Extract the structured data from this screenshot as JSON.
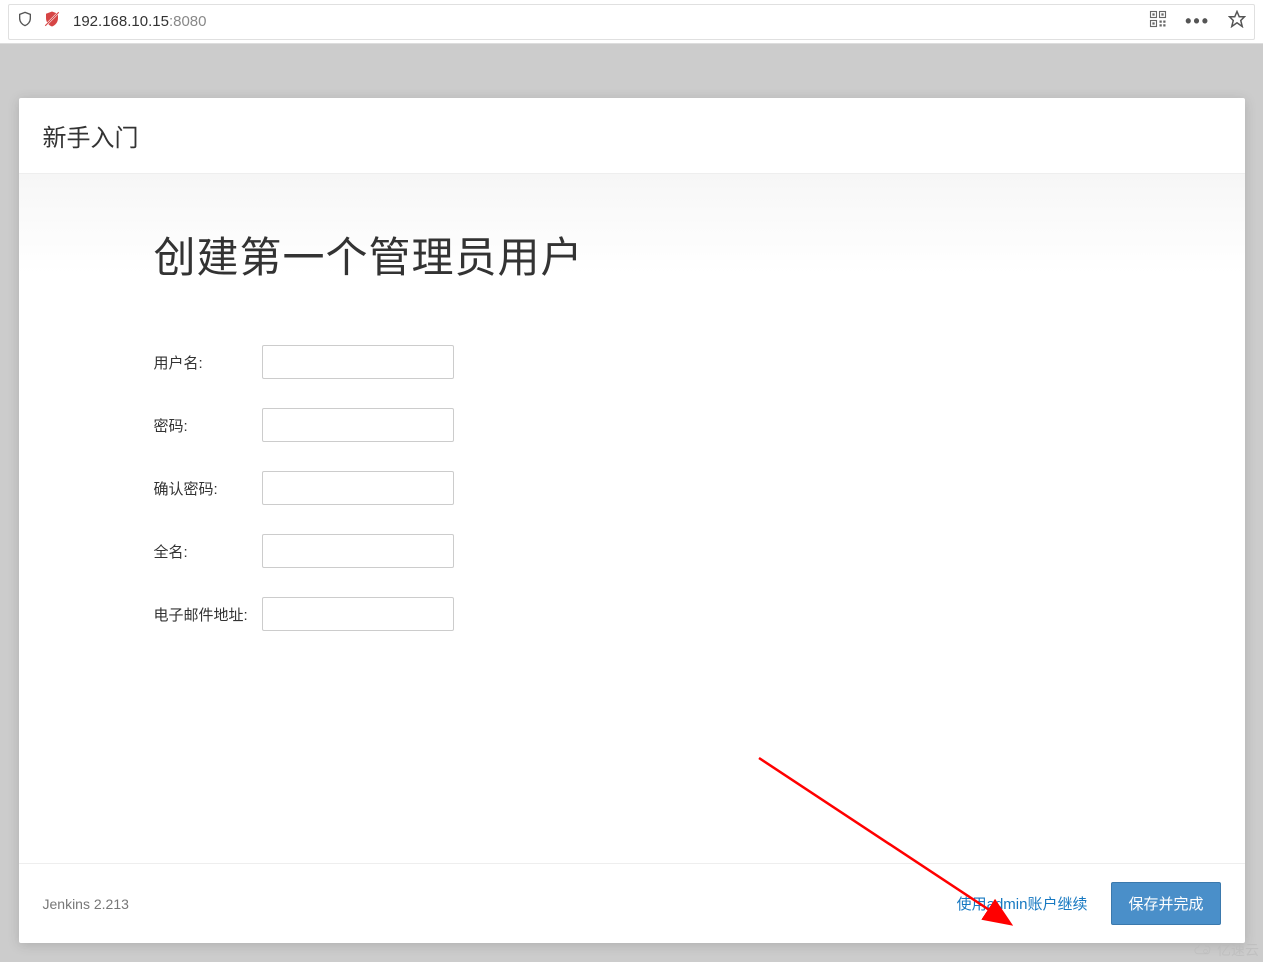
{
  "browser": {
    "url_host": "192.168.10.15",
    "url_port": ":8080"
  },
  "modal": {
    "header_title": "新手入门",
    "main_title": "创建第一个管理员用户"
  },
  "form": {
    "username_label": "用户名:",
    "password_label": "密码:",
    "confirm_password_label": "确认密码:",
    "fullname_label": "全名:",
    "email_label": "电子邮件地址:"
  },
  "footer": {
    "version_text": "Jenkins 2.213",
    "continue_as_admin": "使用admin账户继续",
    "save_and_finish": "保存并完成"
  },
  "watermark": {
    "text": "亿速云"
  }
}
